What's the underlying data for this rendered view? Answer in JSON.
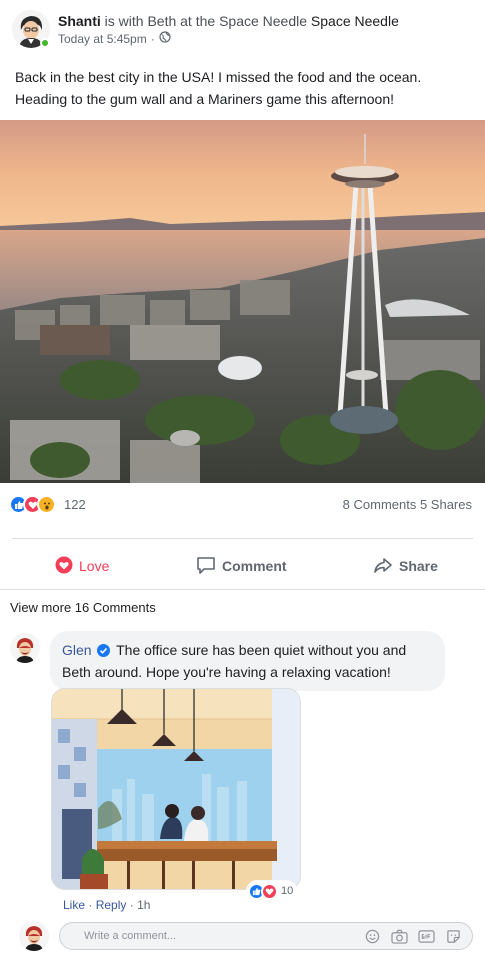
{
  "post": {
    "author": "Shanti",
    "with_text": " is with Beth at the Space Needle ",
    "place": "Space Needle",
    "time": "Today at 5:45pm",
    "separator": "·",
    "body_line1": "Back in the best city in the USA! I missed the food and the ocean.",
    "body_line2": "Heading to the gum wall and a Mariners game this afternoon!"
  },
  "reactions": {
    "count": "122",
    "stats": "8 Comments 5 Shares",
    "icons": [
      "like-icon",
      "love-icon",
      "wow-icon"
    ]
  },
  "actions": {
    "love": "Love",
    "comment": "Comment",
    "share": "Share"
  },
  "comments": {
    "view_more": "View more 16 Comments",
    "items": [
      {
        "author": "Glen",
        "text": " The office sure has been quiet without you and Beth around. Hope you're having a relaxing vacation!",
        "image_reaction_count": "10",
        "like": "Like",
        "reply": "Reply",
        "dot": "·",
        "time": "1h"
      }
    ]
  },
  "composer": {
    "placeholder": "Write a comment...",
    "icons": [
      "emoji-icon",
      "camera-icon",
      "gif-icon",
      "sticker-icon"
    ]
  },
  "colors": {
    "link": "#385898",
    "love": "#f33e58",
    "like": "#1877f2",
    "online": "#42b72a"
  }
}
